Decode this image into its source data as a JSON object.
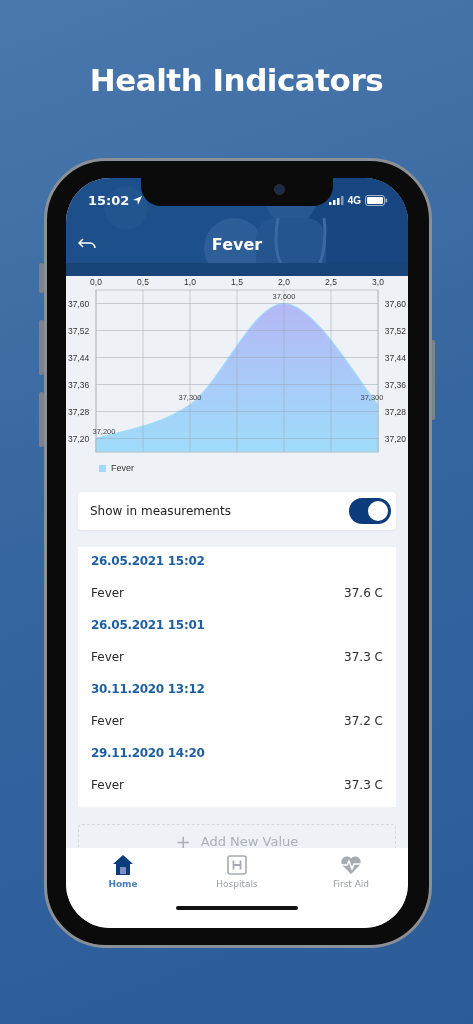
{
  "headline": "Health Indicators",
  "status_bar": {
    "time": "15:02",
    "network": "4G"
  },
  "header": {
    "title": "Fever"
  },
  "chart": {
    "chart_data": {
      "type": "area",
      "x": [
        0,
        1,
        2,
        3
      ],
      "series": [
        {
          "name": "Fever",
          "color": "#9fdcfa",
          "values": [
            37.2,
            37.3,
            37.6,
            37.3
          ]
        }
      ],
      "grid": true,
      "xlim": [
        0,
        3
      ],
      "ylim": [
        37.16,
        37.64
      ],
      "xticks": [
        {
          "value": 0,
          "label": "0,0"
        },
        {
          "value": 0.5,
          "label": "0,5"
        },
        {
          "value": 1,
          "label": "1,0"
        },
        {
          "value": 1.5,
          "label": "1,5"
        },
        {
          "value": 2,
          "label": "2,0"
        },
        {
          "value": 2.5,
          "label": "2,5"
        },
        {
          "value": 3,
          "label": "3,0"
        }
      ],
      "yticks": [
        {
          "value": 37.2,
          "label": "37,20"
        },
        {
          "value": 37.28,
          "label": "37,28"
        },
        {
          "value": 37.36,
          "label": "37,36"
        },
        {
          "value": 37.44,
          "label": "37,44"
        },
        {
          "value": 37.52,
          "label": "37,52"
        },
        {
          "value": 37.6,
          "label": "37,60"
        }
      ],
      "value_labels": [
        "37,200",
        "37,300",
        "37,600",
        "37,300"
      ]
    }
  },
  "toggle": {
    "label": "Show in measurements",
    "on": true
  },
  "entries": [
    {
      "date": "26.05.2021 15:02",
      "name": "Fever",
      "value": "37.6 C"
    },
    {
      "date": "26.05.2021 15:01",
      "name": "Fever",
      "value": "37.3 C"
    },
    {
      "date": "30.11.2020 13:12",
      "name": "Fever",
      "value": "37.2 C"
    },
    {
      "date": "29.11.2020 14:20",
      "name": "Fever",
      "value": "37.3 C"
    }
  ],
  "add_button": {
    "icon": "+",
    "label": "Add New Value"
  },
  "tabs": [
    {
      "label": "Home",
      "selected": true
    },
    {
      "label": "Hospitals",
      "selected": false
    },
    {
      "label": "First Aid",
      "selected": false
    }
  ]
}
